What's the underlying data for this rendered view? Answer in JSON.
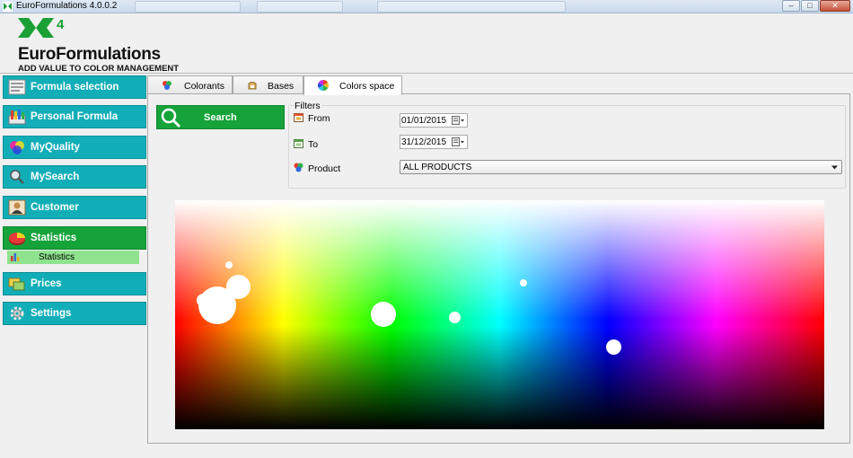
{
  "window": {
    "title": "EuroFormulations 4.0.0.2",
    "buttons": [
      "minimize",
      "maximize",
      "close"
    ]
  },
  "logo": {
    "superscript": "4",
    "name": "EuroFormulations",
    "tagline": "ADD VALUE TO COLOR MANAGEMENT"
  },
  "sidebar": {
    "items": [
      {
        "label": "Formula selection",
        "icon": "formula-icon"
      },
      {
        "label": "Personal Formula",
        "icon": "personal-formula-icon"
      },
      {
        "label": "MyQuality",
        "icon": "quality-icon"
      },
      {
        "label": "MySearch",
        "icon": "magnifier-icon"
      },
      {
        "label": "Customer",
        "icon": "customer-icon"
      },
      {
        "label": "Statistics",
        "icon": "pie-chart-icon",
        "active": true
      },
      {
        "label": "Prices",
        "icon": "prices-icon"
      },
      {
        "label": "Settings",
        "icon": "gear-icon"
      }
    ],
    "subitem": {
      "label": "Statistics",
      "icon": "bar-chart-icon"
    }
  },
  "tabs": [
    {
      "label": "Colorants",
      "icon": "colorants-icon"
    },
    {
      "label": "Bases",
      "icon": "bases-icon"
    },
    {
      "label": "Colors space",
      "icon": "color-wheel-icon",
      "active": true
    }
  ],
  "search": {
    "label": "Search"
  },
  "filters": {
    "legend": "Filters",
    "from": {
      "label": "From",
      "value": "01/01/2015"
    },
    "to": {
      "label": "To",
      "value": "31/12/2015"
    },
    "product": {
      "label": "Product",
      "value": "ALL PRODUCTS"
    }
  },
  "colors": {
    "accent_teal": "#12aeb8",
    "accent_green": "#15a33a",
    "sub_green": "#8fe38f"
  }
}
